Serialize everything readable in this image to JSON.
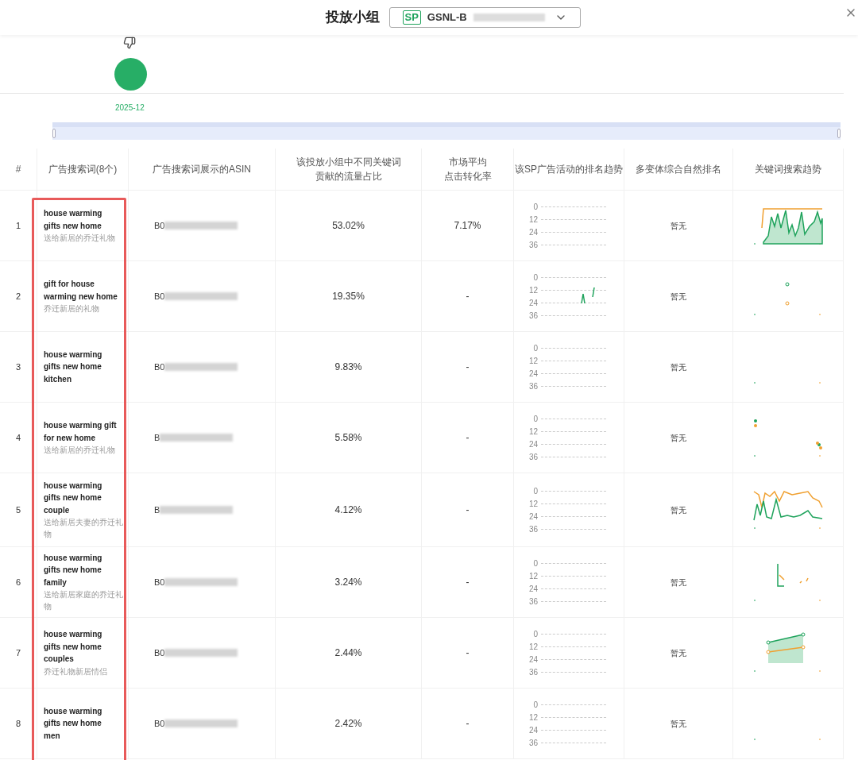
{
  "dialog": {
    "title": "投放小组",
    "group_select": {
      "badge": "SP",
      "value": "GSNL-B"
    }
  },
  "timeline": {
    "label": "2025-12",
    "range": {
      "level": 1
    }
  },
  "table": {
    "keyword_column_highlighted": true,
    "columns": [
      [
        "#"
      ],
      [
        "广告搜索词(8个)"
      ],
      [
        "广告搜索词展示的ASIN"
      ],
      [
        "该投放小组中不同关键词",
        "贡献的流量占比"
      ],
      [
        "市场平均",
        "点击转化率"
      ],
      [
        "该SP广告活动的排名趋势"
      ],
      [
        "多变体综合自然排名"
      ],
      [
        "关键词搜索趋势"
      ]
    ],
    "rows": [
      {
        "index": "1",
        "keyword": "house warming gifts new home",
        "translation": "送给新居的乔迁礼物",
        "asin": "B0",
        "traffic_share": "53.02%",
        "conversion_rate": "7.17%",
        "rank_ticks": [
          "0",
          "12",
          "24",
          "36"
        ],
        "natural_rank": "暂无"
      },
      {
        "index": "2",
        "keyword": "gift for house warming new home",
        "translation": "乔迁新居的礼物",
        "asin": "B0",
        "traffic_share": "19.35%",
        "conversion_rate": "-",
        "rank_ticks": [
          "0",
          "12",
          "24",
          "36"
        ],
        "natural_rank": "暂无"
      },
      {
        "index": "3",
        "keyword": "house warming gifts new home kitchen",
        "asin": "B0",
        "traffic_share": "9.83%",
        "conversion_rate": "-",
        "rank_ticks": [
          "0",
          "12",
          "24",
          "36"
        ],
        "natural_rank": "暂无"
      },
      {
        "index": "4",
        "keyword": "house warming gift for new home",
        "translation": "送给新居的乔迁礼物",
        "asin": "B",
        "traffic_share": "5.58%",
        "conversion_rate": "-",
        "rank_ticks": [
          "0",
          "12",
          "24",
          "36"
        ],
        "natural_rank": "暂无"
      },
      {
        "index": "5",
        "keyword": "house warming gifts new home couple",
        "translation": "送给新居夫妻的乔迁礼物",
        "asin": "B",
        "traffic_share": "4.12%",
        "conversion_rate": "-",
        "rank_ticks": [
          "0",
          "12",
          "24",
          "36"
        ],
        "natural_rank": "暂无"
      },
      {
        "index": "6",
        "keyword": "house warming gifts new home family",
        "translation": "送给新居家庭的乔迁礼物",
        "asin": "B0",
        "traffic_share": "3.24%",
        "conversion_rate": "-",
        "rank_ticks": [
          "0",
          "12",
          "24",
          "36"
        ],
        "natural_rank": "暂无"
      },
      {
        "index": "7",
        "keyword": "house warming gifts new home couples",
        "translation": "乔迁礼物新居情侣",
        "asin": "B0",
        "traffic_share": "2.44%",
        "conversion_rate": "-",
        "rank_ticks": [
          "0",
          "12",
          "24",
          "36"
        ],
        "natural_rank": "暂无"
      },
      {
        "index": "8",
        "keyword": "house warming gifts new home men",
        "asin": "B0",
        "traffic_share": "2.42%",
        "conversion_rate": "-",
        "rank_ticks": [
          "0",
          "12",
          "24",
          "36"
        ],
        "natural_rank": "暂无"
      }
    ]
  }
}
